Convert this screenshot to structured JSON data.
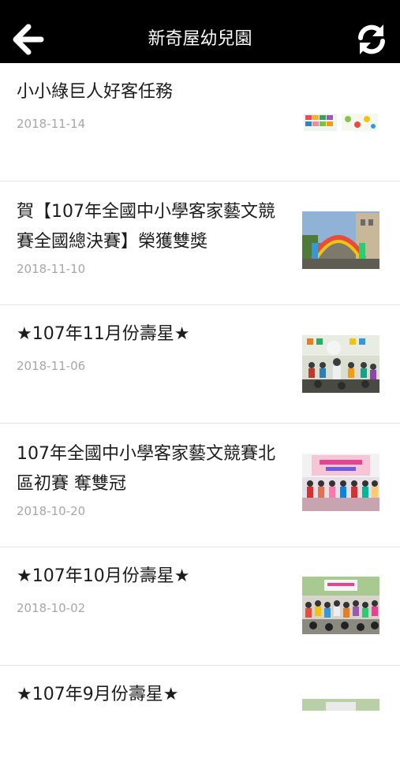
{
  "header": {
    "title": "新奇屋幼兒園",
    "back_icon": "arrow-left-icon",
    "refresh_icon": "refresh-icon"
  },
  "news": [
    {
      "title": "小小綠巨人好客任務",
      "date": "2018-11-14"
    },
    {
      "title": "賀【107年全國中小學客家藝文競賽全國總決賽】榮獲雙獎",
      "date": "2018-11-10"
    },
    {
      "title": "★107年11月份壽星★",
      "date": "2018-11-06"
    },
    {
      "title": "107年全國中小學客家藝文競賽北區初賽 奪雙冠",
      "date": "2018-10-20"
    },
    {
      "title": "★107年10月份壽星★",
      "date": "2018-10-02"
    },
    {
      "title": "★107年9月份壽星★",
      "date": ""
    }
  ]
}
